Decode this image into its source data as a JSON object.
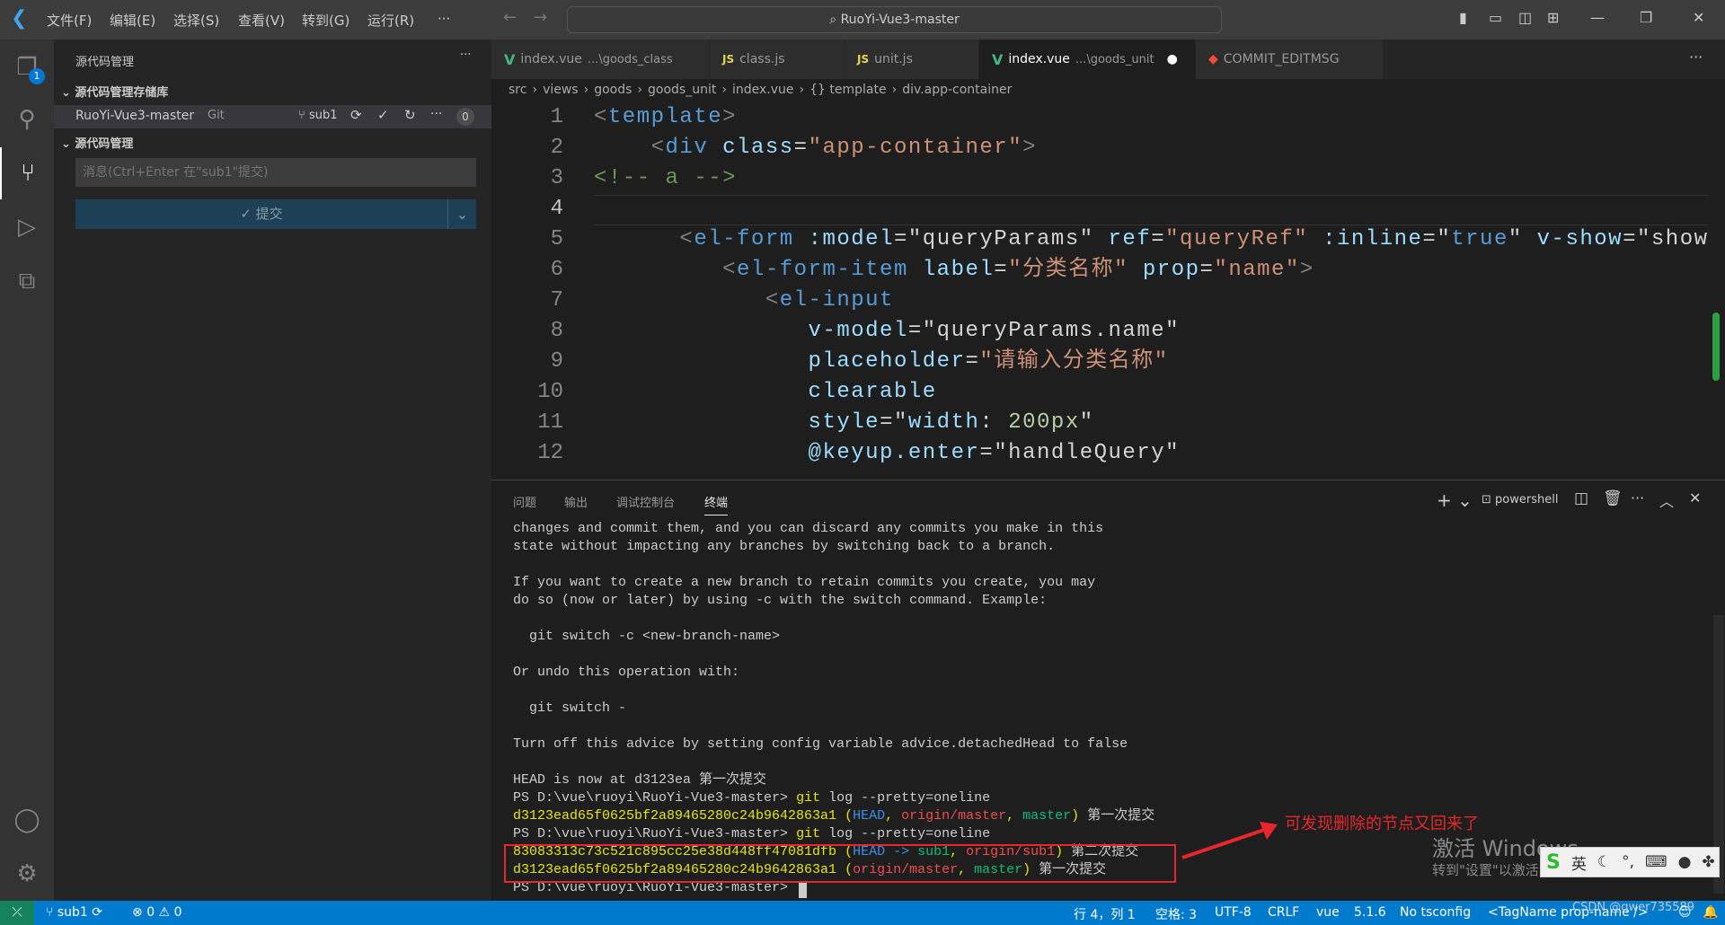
{
  "titlebar": {
    "menus": [
      "文件(F)",
      "编辑(E)",
      "选择(S)",
      "查看(V)",
      "转到(G)",
      "运行(R)",
      "···"
    ],
    "search": "RuoYi-Vue3-master"
  },
  "activity": {
    "explorer_badge": "1"
  },
  "sidebar": {
    "title": "源代码管理",
    "more": "···",
    "repos_section": "源代码管理存储库",
    "repo_name": "RuoYi-Vue3-master",
    "repo_type": "Git",
    "branch": "sub1",
    "count": "0",
    "scm_section": "源代码管理",
    "message_placeholder": "消息(Ctrl+Enter 在\"sub1\"提交)",
    "commit_label": "✓ 提交"
  },
  "tabs": [
    {
      "icon": "V",
      "name": "index.vue",
      "desc": "...\\goods_class"
    },
    {
      "icon": "JS",
      "name": "class.js",
      "desc": ""
    },
    {
      "icon": "JS",
      "name": "unit.js",
      "desc": ""
    },
    {
      "icon": "V",
      "name": "index.vue",
      "desc": "...\\goods_unit",
      "active": true,
      "dirty": "●"
    },
    {
      "icon": "◆",
      "name": "COMMIT_EDITMSG",
      "desc": ""
    }
  ],
  "breadcrumb": [
    "src",
    "views",
    "goods",
    "goods_unit",
    "index.vue",
    "{} template",
    "div.app-container"
  ],
  "code": [
    [
      [
        "t-p",
        "<"
      ],
      [
        "t-tag",
        "template"
      ],
      [
        "t-p",
        ">"
      ]
    ],
    [
      [
        "t-w",
        "    "
      ],
      [
        "t-p",
        "<"
      ],
      [
        "t-tag",
        "div"
      ],
      [
        "t-w",
        " "
      ],
      [
        "t-a",
        "class"
      ],
      [
        "t-w",
        "="
      ],
      [
        "t-s",
        "\"app-container\""
      ],
      [
        "t-p",
        ">"
      ]
    ],
    [
      [
        "t-c",
        "<!-- a -->"
      ]
    ],
    [],
    [
      [
        "t-w",
        "      "
      ],
      [
        "t-p",
        "<"
      ],
      [
        "t-tag",
        "el-form"
      ],
      [
        "t-w",
        " "
      ],
      [
        "t-a",
        ":model"
      ],
      [
        "t-w",
        "=\"queryParams\" "
      ],
      [
        "t-a",
        "ref"
      ],
      [
        "t-w",
        "="
      ],
      [
        "t-s",
        "\"queryRef\""
      ],
      [
        "t-w",
        " "
      ],
      [
        "t-a",
        ":inline"
      ],
      [
        "t-w",
        "=\""
      ],
      [
        "t-tag",
        "true"
      ],
      [
        "t-w",
        "\" "
      ],
      [
        "t-a",
        "v-show"
      ],
      [
        "t-w",
        "=\"show"
      ]
    ],
    [
      [
        "t-w",
        "         "
      ],
      [
        "t-p",
        "<"
      ],
      [
        "t-tag",
        "el-form-item"
      ],
      [
        "t-w",
        " "
      ],
      [
        "t-a",
        "label"
      ],
      [
        "t-w",
        "="
      ],
      [
        "t-s",
        "\"分类名称\""
      ],
      [
        "t-w",
        " "
      ],
      [
        "t-a",
        "prop"
      ],
      [
        "t-w",
        "="
      ],
      [
        "t-s",
        "\"name\""
      ],
      [
        "t-p",
        ">"
      ]
    ],
    [
      [
        "t-w",
        "            "
      ],
      [
        "t-p",
        "<"
      ],
      [
        "t-tag",
        "el-input"
      ]
    ],
    [
      [
        "t-w",
        "               "
      ],
      [
        "t-a",
        "v-model"
      ],
      [
        "t-w",
        "=\"queryParams.name\""
      ]
    ],
    [
      [
        "t-w",
        "               "
      ],
      [
        "t-a",
        "placeholder"
      ],
      [
        "t-w",
        "="
      ],
      [
        "t-s",
        "\"请输入分类名称\""
      ]
    ],
    [
      [
        "t-w",
        "               "
      ],
      [
        "t-a",
        "clearable"
      ]
    ],
    [
      [
        "t-w",
        "               "
      ],
      [
        "t-a",
        "style"
      ],
      [
        "t-w",
        "=\""
      ],
      [
        "t-a",
        "width"
      ],
      [
        "t-w",
        ": "
      ],
      [
        "t-n",
        "200px"
      ],
      [
        "t-w",
        "\""
      ]
    ],
    [
      [
        "t-w",
        "               "
      ],
      [
        "t-a",
        "@keyup.enter"
      ],
      [
        "t-w",
        "=\"handleQuery\""
      ]
    ]
  ],
  "panel": {
    "tabs": [
      "问题",
      "输出",
      "调试控制台",
      "终端"
    ],
    "shell": "powershell"
  },
  "terminal": [
    [
      [
        "",
        "changes and commit them, and you can discard any commits you make in this"
      ]
    ],
    [
      [
        "",
        "state without impacting any branches by switching back to a branch."
      ]
    ],
    [],
    [
      [
        "",
        "If you want to create a new branch to retain commits you create, you may"
      ]
    ],
    [
      [
        "",
        "do so (now or later) by using -c with the switch command. Example:"
      ]
    ],
    [],
    [
      [
        "",
        "  git switch -c <new-branch-name>"
      ]
    ],
    [],
    [
      [
        "",
        "Or undo this operation with:"
      ]
    ],
    [],
    [
      [
        "",
        "  git switch -"
      ]
    ],
    [],
    [
      [
        "",
        "Turn off this advice by setting config variable advice.detachedHead to false"
      ]
    ],
    [],
    [
      [
        "",
        "HEAD is now at d3123ea 第一次提交"
      ]
    ],
    [
      [
        "",
        "PS D:\\vue\\ruoyi\\RuoYi-Vue3-master> "
      ],
      [
        "y",
        "git"
      ],
      [
        "",
        " log --pretty=oneline"
      ]
    ],
    [
      [
        "y",
        "d3123ead65f0625bf2a89465280c24b9642863a1"
      ],
      [
        "y",
        " ("
      ],
      [
        "b",
        "HEAD"
      ],
      [
        "y",
        ", "
      ],
      [
        "r",
        "origin/master"
      ],
      [
        "y",
        ", "
      ],
      [
        "g",
        "master"
      ],
      [
        "y",
        ")"
      ],
      [
        "",
        " 第一次提交"
      ]
    ],
    [
      [
        "",
        "PS D:\\vue\\ruoyi\\RuoYi-Vue3-master> "
      ],
      [
        "y",
        "git"
      ],
      [
        "",
        " log --pretty=oneline"
      ]
    ],
    [
      [
        "y",
        "83083313c73c521c895cc25e38d448ff47081dfb"
      ],
      [
        "y",
        " ("
      ],
      [
        "b",
        "HEAD -> "
      ],
      [
        "g",
        "sub1"
      ],
      [
        "y",
        ", "
      ],
      [
        "r",
        "origin/sub1"
      ],
      [
        "y",
        ")"
      ],
      [
        "",
        " 第二次提交"
      ]
    ],
    [
      [
        "y",
        "d3123ead65f0625bf2a89465280c24b9642863a1"
      ],
      [
        "y",
        " ("
      ],
      [
        "r",
        "origin/master"
      ],
      [
        "y",
        ", "
      ],
      [
        "g",
        "master"
      ],
      [
        "y",
        ")"
      ],
      [
        "",
        " 第一次提交"
      ]
    ],
    [
      [
        "",
        "PS D:\\vue\\ruoyi\\RuoYi-Vue3-master> "
      ]
    ]
  ],
  "annotation": {
    "text": "可发现删除的节点又回来了",
    "color": "#e8262b"
  },
  "watermark": {
    "line1": "激活 Windows",
    "line2": "转到\"设置\"以激活 Windows。",
    "csdn": "CSDN @qwer735589"
  },
  "ime": {
    "lang": "英"
  },
  "status": {
    "branch": "sub1",
    "errors": "0",
    "warnings": "0",
    "position": "行 4，列 1",
    "spaces": "空格: 3",
    "encoding": "UTF-8",
    "eol": "CRLF",
    "language": "vue",
    "version": "5.1.6",
    "tsconfig": "No tsconfig",
    "tagname": "<TagName prop-name />"
  },
  "colors": {
    "statusbar": "#007acc",
    "accent": "#41b883"
  }
}
